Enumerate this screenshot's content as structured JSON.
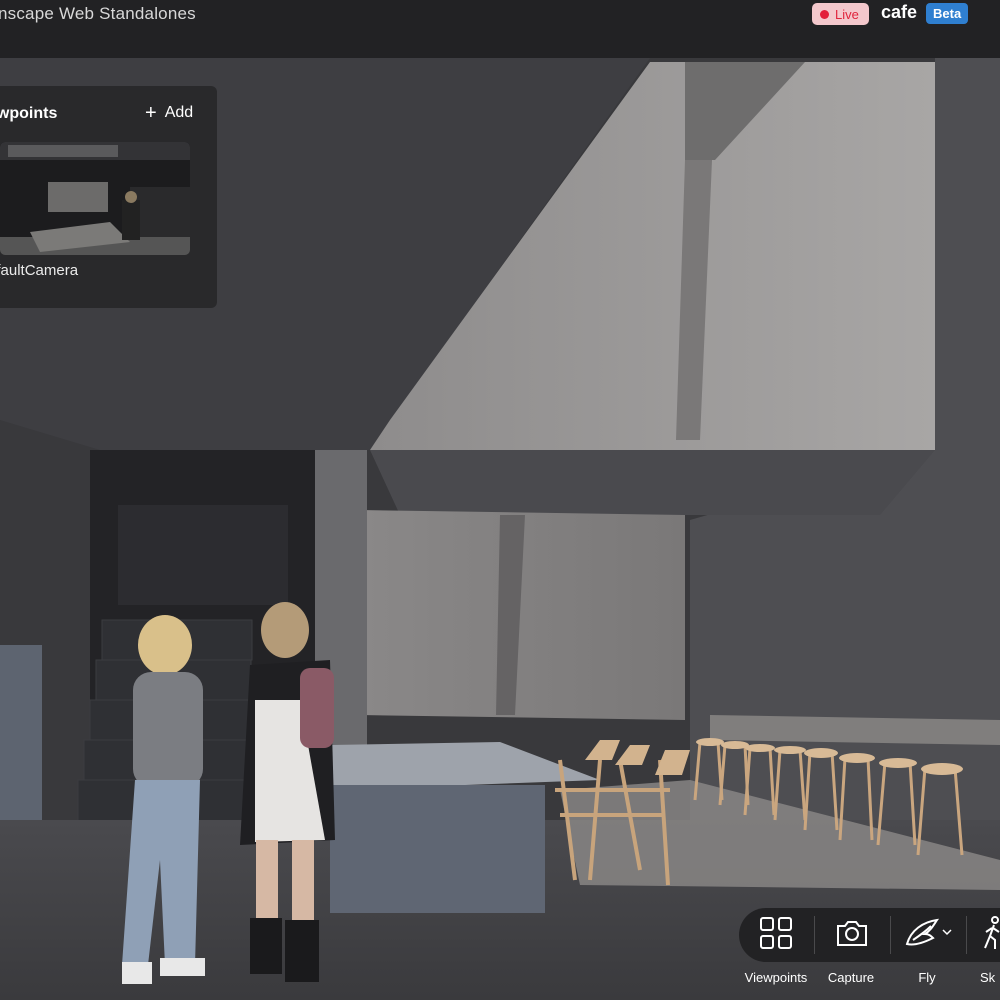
{
  "topbar": {
    "app_title": "nscape Web Standalones",
    "live_label": "Live",
    "project_name": "cafe",
    "beta_label": "Beta"
  },
  "viewpoints_panel": {
    "title": "ewpoints",
    "add_label": "Add",
    "add_icon": "plus-icon",
    "items": [
      {
        "label": "efaultCamera"
      }
    ]
  },
  "toolbar": {
    "buttons": [
      {
        "label": "Viewpoints",
        "icon": "grid-icon"
      },
      {
        "label": "Capture",
        "icon": "camera-icon"
      },
      {
        "label": "Fly",
        "icon": "wing-icon"
      },
      {
        "label": "Sk",
        "icon": "walk-icon"
      }
    ]
  },
  "colors": {
    "live_badge_bg": "#f4c8cc",
    "live_dot": "#e3203a",
    "beta_badge_bg": "#2f7fd0",
    "panel_bg": "#28282a",
    "topbar_bg": "#222224"
  }
}
